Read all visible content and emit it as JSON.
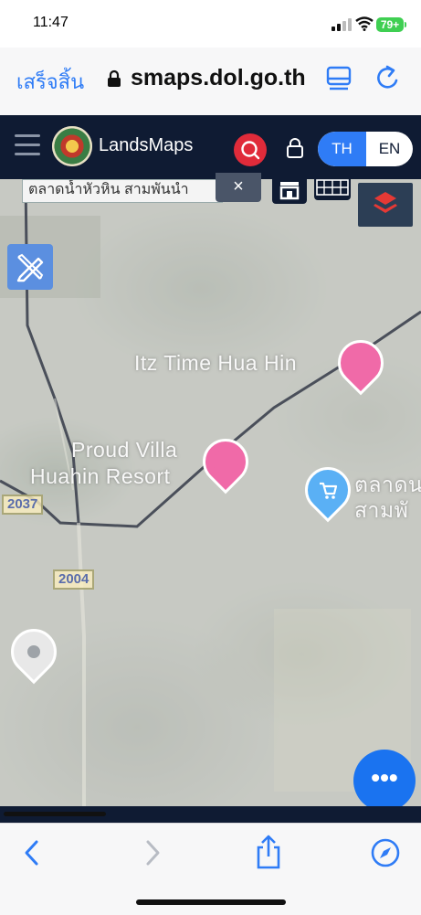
{
  "status_bar": {
    "time": "11:47",
    "battery": "79+"
  },
  "browser": {
    "done_label": "เสร็จสิ้น",
    "url": "smaps.dol.go.th"
  },
  "app": {
    "brand": "LandsMaps",
    "lang_th": "TH",
    "lang_en": "EN"
  },
  "map": {
    "search_value": "ตลาดน้ำหัวหิน สามพันนำ",
    "clear_label": "×",
    "labels": {
      "itz_time": "Itz Time Hua Hin",
      "proud_villa_1": "Proud Villa",
      "proud_villa_2": "Huahin Resort",
      "market_1": "ตลาดน",
      "market_2": "สามพั"
    },
    "road_shields": [
      "2037",
      "2004"
    ],
    "fab_label": "•••"
  },
  "colors": {
    "accent": "#2f7cf6",
    "header_bg": "#0f1b33",
    "search_red": "#e02b3a",
    "poi_pink": "#f06aa8",
    "poi_blue": "#5ab0f5"
  }
}
